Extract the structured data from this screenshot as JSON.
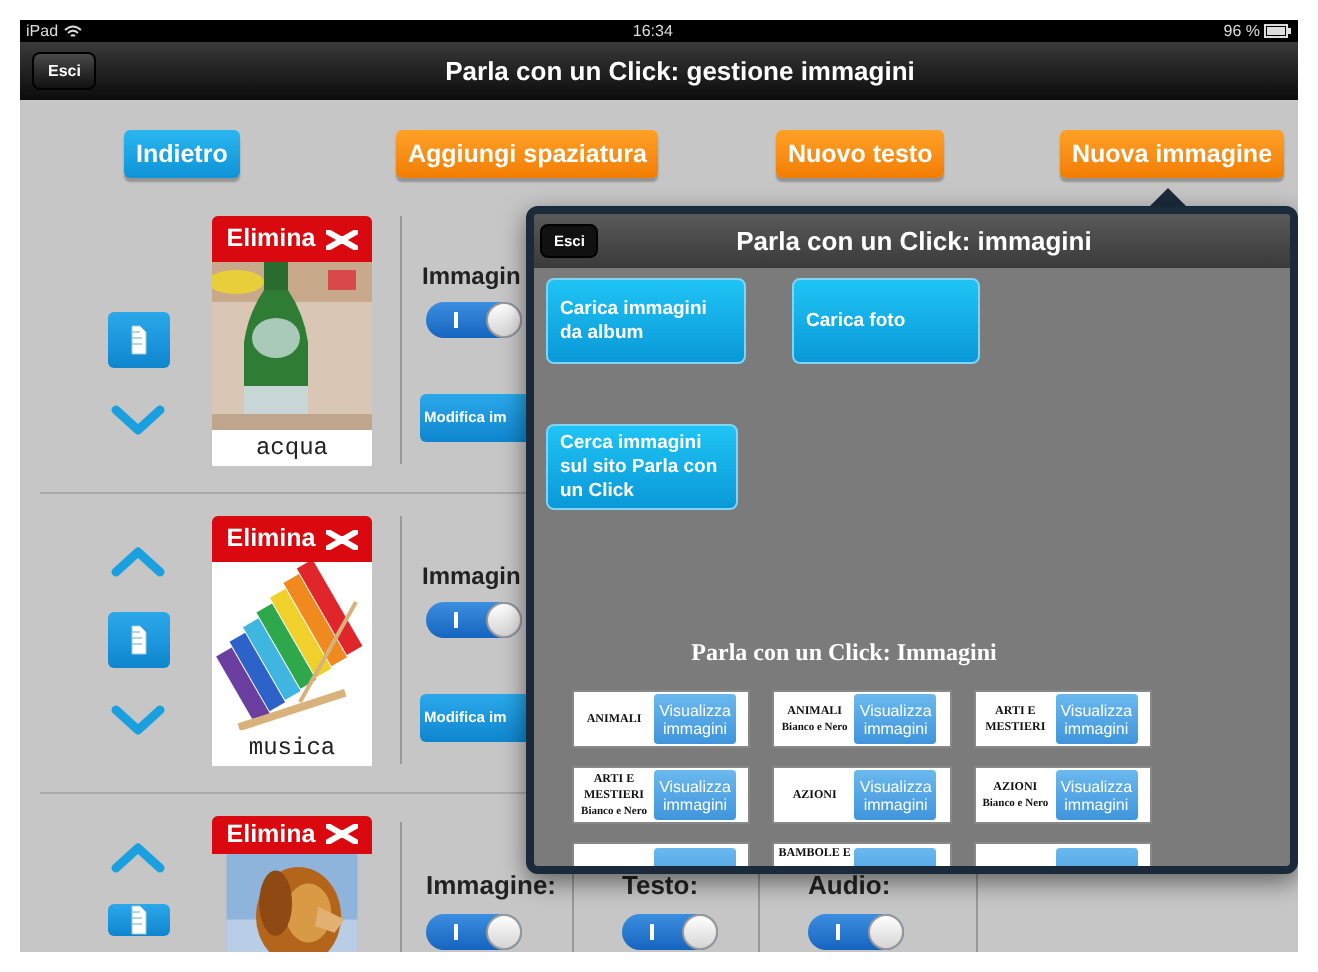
{
  "status_bar": {
    "device": "iPad",
    "time": "16:34",
    "battery": "96 %"
  },
  "nav_bar": {
    "exit_button": "Esci",
    "title": "Parla con un Click: gestione immagini"
  },
  "toolbar": [
    {
      "label": "Indietro",
      "kind": "blue"
    },
    {
      "label": "Aggiungi spaziatura",
      "kind": "orange"
    },
    {
      "label": "Nuovo testo",
      "kind": "orange"
    },
    {
      "label": "Nuova immagine",
      "kind": "orange"
    }
  ],
  "rows": [
    {
      "move_up": false,
      "move_down": true,
      "delete_button": "Elimina",
      "caption": "acqua",
      "image_label": "Immagin",
      "image_toggle": true,
      "edit_button": "Modifica im"
    },
    {
      "move_up": true,
      "move_down": true,
      "delete_button": "Elimina",
      "caption": "musica",
      "image_label": "Immagin",
      "image_toggle": true,
      "edit_button": "Modifica im"
    },
    {
      "move_up": true,
      "move_down": false,
      "delete_button": "Elimina",
      "image_label": "Immagine:",
      "image_toggle": true,
      "text_label": "Testo:",
      "text_toggle": true,
      "audio_label": "Audio:",
      "audio_toggle": true
    }
  ],
  "popup": {
    "exit_button": "Esci",
    "title": "Parla con un Click: immagini",
    "actions": [
      "Carica immagini da album",
      "Carica foto",
      "Cerca immagini sul sito Parla con un Click"
    ],
    "web_heading": "Parla con un Click: Immagini",
    "categories": [
      {
        "kind": "full",
        "name": "ANIMALI",
        "button": "Visualizza immagini"
      },
      {
        "kind": "full",
        "name": "ANIMALI",
        "subtitle": "Bianco e Nero",
        "button": "Visualizza immagini"
      },
      {
        "kind": "full",
        "name": "ARTI E MESTIERI",
        "button": "Visualizza immagini"
      },
      {
        "kind": "full",
        "name": "ARTI E MESTIERI",
        "subtitle": "Bianco e Nero",
        "button": "Visualizza immagini"
      },
      {
        "kind": "full",
        "name": "AZIONI",
        "button": "Visualizza immagini"
      },
      {
        "kind": "full",
        "name": "AZIONI",
        "subtitle": "Bianco e Nero",
        "button": "Visualizza immagini"
      },
      {
        "kind": "clipped"
      },
      {
        "kind": "clipped",
        "name": "BAMBOLE E"
      },
      {
        "kind": "clipped"
      }
    ]
  }
}
